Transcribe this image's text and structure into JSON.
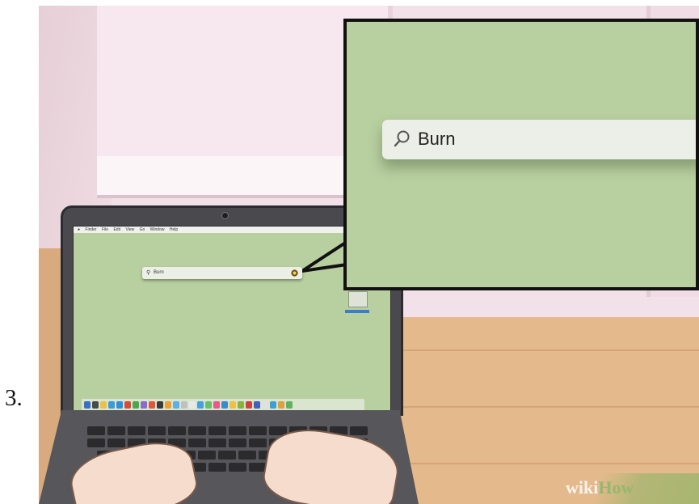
{
  "step": {
    "number": "3."
  },
  "laptop": {
    "menu_bar": {
      "items": [
        "Finder",
        "File",
        "Edit",
        "View",
        "Go",
        "Window",
        "Help"
      ]
    },
    "spotlight": {
      "icon": "search-icon",
      "query": "Burn",
      "result_icon": "burn-app-icon"
    },
    "dock": {
      "icon_colors": [
        "#3a6fc9",
        "#4a4a4a",
        "#e8c24a",
        "#3b9ad9",
        "#2d8fe0",
        "#d94a3a",
        "#4aa84a",
        "#8a6ad0",
        "#e0563a",
        "#3a3a3a",
        "#f0a030",
        "#5ab0e8",
        "#c0c0c0",
        "#e8e8e8",
        "#46a0e0",
        "#6ac06a",
        "#e85a8a",
        "#3a8ad0",
        "#f0c040",
        "#8ab040",
        "#d04040",
        "#4060c0",
        "#e0e0e0",
        "#40a0d0",
        "#e0a040",
        "#60b060"
      ]
    }
  },
  "zoom": {
    "search_icon": "search-icon",
    "query": "Burn"
  },
  "watermark": {
    "part1": "wiki",
    "part2": "How"
  },
  "colors": {
    "desktop_green": "#b8cfa0",
    "wall_pink": "#f3e1e9",
    "desk_wood": "#e4b98c"
  }
}
